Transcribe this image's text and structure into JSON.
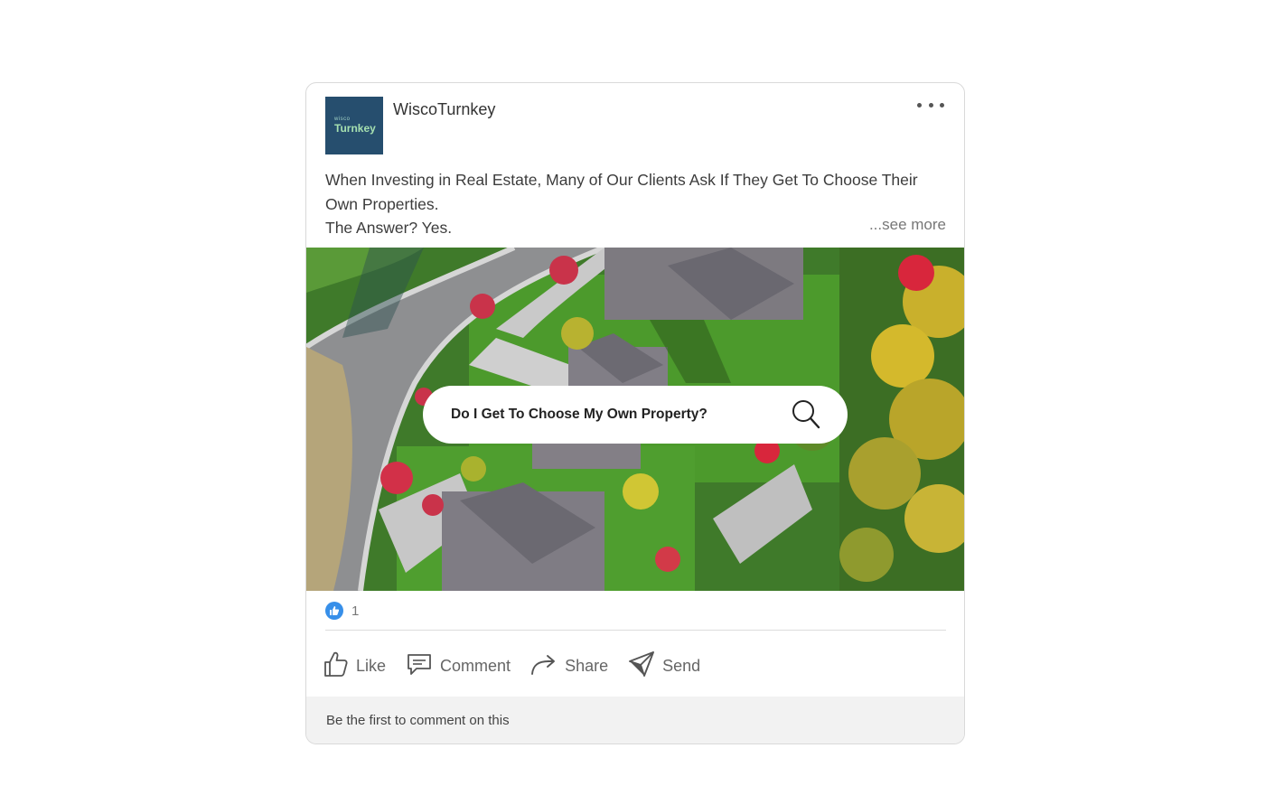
{
  "post": {
    "author": "WiscoTurnkey",
    "logo_small": "wisco",
    "logo_big": "Turnkey",
    "text_line1": "When Investing in Real Estate, Many of Our Clients Ask If They Get To Choose Their Own Properties.",
    "text_line2": "The Answer? Yes.",
    "see_more": "...see more",
    "image_search_text": "Do I Get To Choose My Own Property?"
  },
  "reactions": {
    "icon": "like-icon",
    "count": "1"
  },
  "actions": {
    "like": "Like",
    "comment": "Comment",
    "share": "Share",
    "send": "Send"
  },
  "comments": {
    "prompt": "Be the first to comment on this"
  },
  "colors": {
    "logo_bg": "#264e6e",
    "like_badge": "#378fe9",
    "comment_bar": "#f2f2f2"
  }
}
